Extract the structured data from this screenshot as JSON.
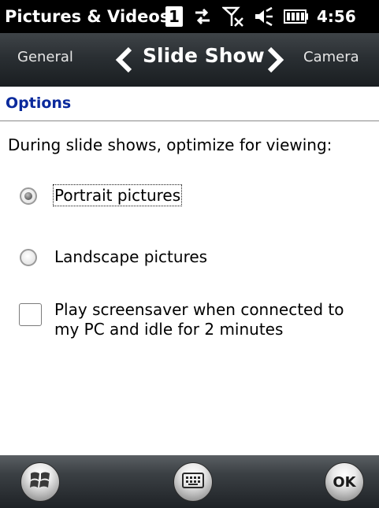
{
  "status": {
    "app_title": "Pictures & Videos",
    "badge": "1",
    "time": "4:56",
    "icons": [
      "sync-arrows-icon",
      "no-signal-icon",
      "speaker-icon",
      "battery-icon"
    ]
  },
  "tabs": {
    "prev": "General",
    "current": "Slide Show",
    "next": "Camera"
  },
  "section": {
    "title": "Options"
  },
  "content": {
    "prompt": "During slide shows, optimize for viewing:",
    "options": [
      {
        "label": "Portrait pictures",
        "selected": true
      },
      {
        "label": "Landscape pictures",
        "selected": false
      }
    ],
    "screensaver": {
      "line1": "Play screensaver when connected to",
      "line2": "my PC and idle for 2 minutes",
      "checked": false
    }
  },
  "bottombar": {
    "ok_label": "OK",
    "icons": [
      "windows-start-icon",
      "keyboard-icon",
      "ok-icon"
    ]
  }
}
